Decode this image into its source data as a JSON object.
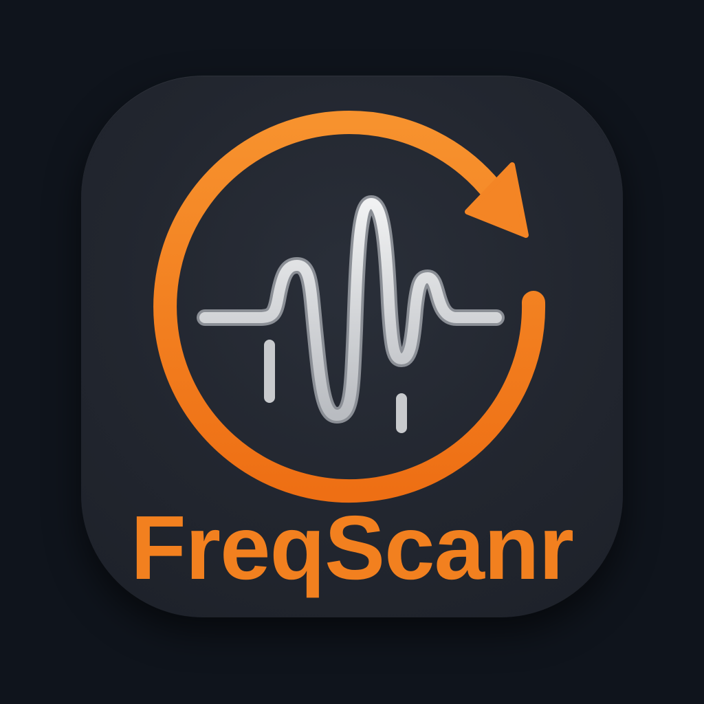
{
  "app": {
    "name": "FreqScanr"
  },
  "icons": {
    "rotate": "refresh-arrow-icon",
    "signal": "waveform-icon"
  },
  "colors": {
    "background": "#0f141c",
    "tile": "#22262f",
    "accent": "#f2801f",
    "accent_light": "#f79a3a",
    "waveform": "#d9dbde"
  }
}
